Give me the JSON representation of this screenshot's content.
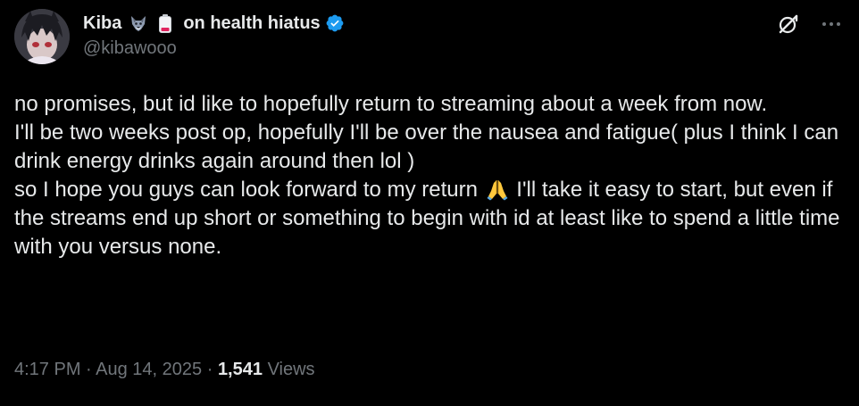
{
  "author": {
    "display_name": "Kiba",
    "display_name_suffix": "on health hiatus",
    "emojis": [
      "wolf-emoji",
      "low-battery-emoji"
    ],
    "handle": "@kibawooo",
    "verified": true
  },
  "icons": {
    "grok": "grok-icon",
    "more": "more-icon"
  },
  "tweet": {
    "line1": "no promises, but id like to hopefully return to streaming about a week from now.",
    "line2": "I'll be two weeks post op, hopefully I'll be over the nausea and fatigue( plus I think I can drink energy drinks again around then lol )",
    "line3_before_emoji": "so I hope you guys can look forward to my return ",
    "line3_emoji": "folded-hands-emoji",
    "line3_after_emoji": " I'll take it easy to start, but even if the streams end up short or something to begin with id at least like to spend a little time with you versus none."
  },
  "meta": {
    "time": "4:17 PM",
    "separator": " · ",
    "date": "Aug 14, 2025",
    "views_count": "1,541",
    "views_label": "Views"
  },
  "colors": {
    "background": "#000000",
    "text": "#e7e9ea",
    "secondary": "#71767b",
    "verified": "#1d9bf0"
  }
}
